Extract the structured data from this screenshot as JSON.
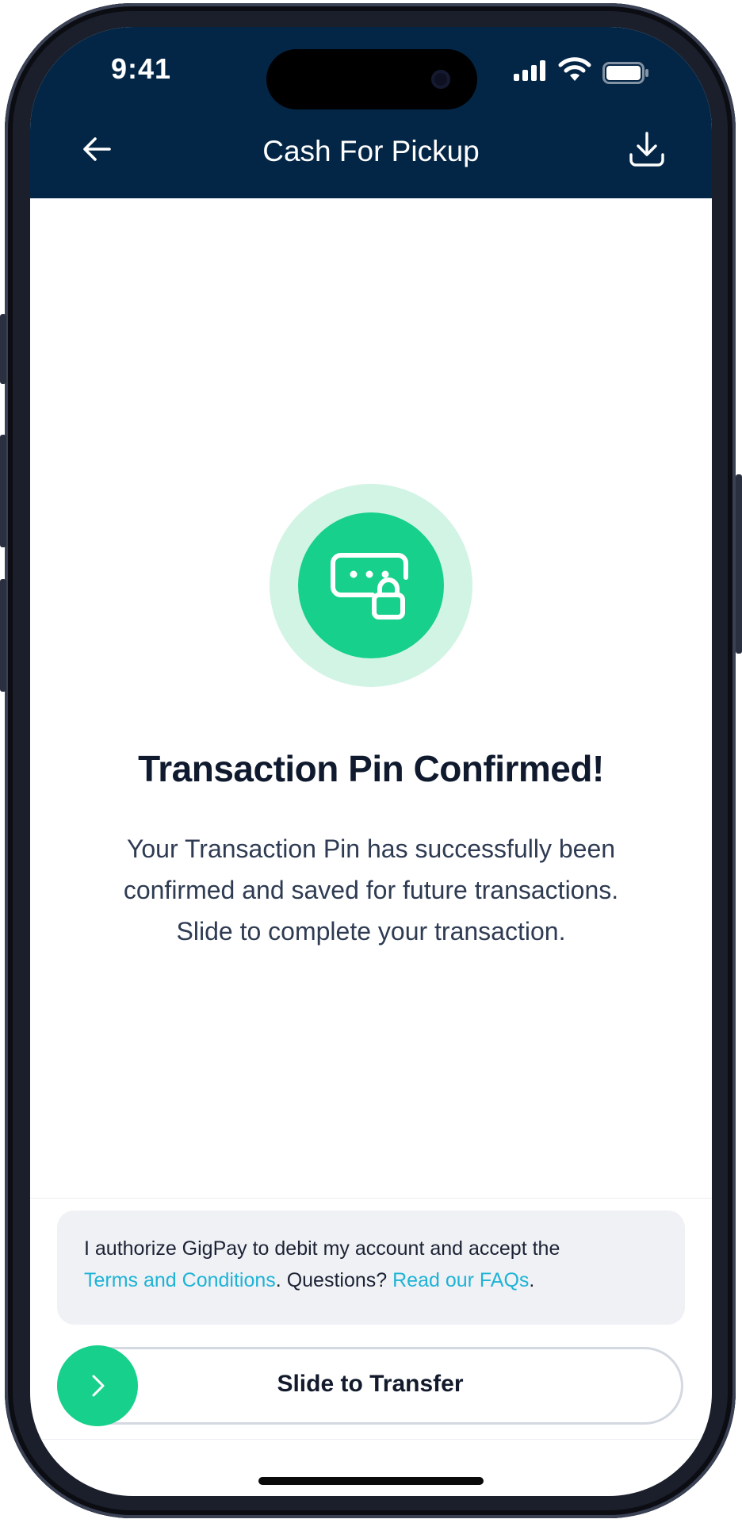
{
  "status_bar": {
    "time": "9:41",
    "icons": [
      "signal-icon",
      "wifi-icon",
      "battery-icon"
    ]
  },
  "header": {
    "title": "Cash For Pickup",
    "back_icon": "arrow-left-icon",
    "download_icon": "download-icon"
  },
  "success": {
    "icon": "keyboard-lock-icon",
    "title": "Transaction Pin Confirmed!",
    "description_lines": [
      "Your Transaction Pin has successfully been",
      "confirmed and saved for future transactions.",
      "Slide to complete your transaction."
    ]
  },
  "authorization": {
    "text_before": "I authorize GigPay to debit my account and accept the",
    "terms_link": "Terms and Conditions",
    "text_middle": ". Questions? ",
    "faq_link": "Read our FAQs",
    "text_after": "."
  },
  "slider": {
    "label": "Slide to Transfer",
    "knob_icon": "chevron-right-icon"
  },
  "colors": {
    "header_bg": "#042646",
    "accent_green": "#17d08b",
    "accent_green_light": "#d2f4e5",
    "link": "#1eb3d6"
  }
}
